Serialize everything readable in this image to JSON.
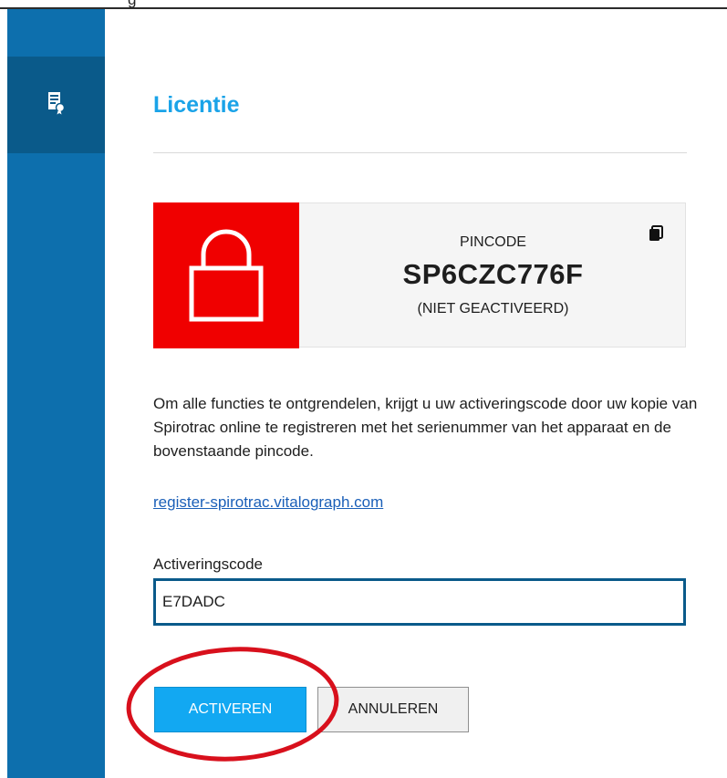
{
  "window": {
    "top_text_fragment": "g"
  },
  "sidebar": {
    "items": [
      {
        "icon": "license-certificate-icon",
        "active": true
      }
    ]
  },
  "page": {
    "title": "Licentie"
  },
  "pin": {
    "label": "PINCODE",
    "code": "SP6CZC776F",
    "status": "(NIET GEACTIVEERD)",
    "lock_icon": "padlock-icon",
    "copy_icon": "copy-icon"
  },
  "description": "Om alle functies te ontgrendelen, krijgt u uw activeringscode door uw kopie van Spirotrac online te registreren met het serienummer van het apparaat en de bovenstaande pincode.",
  "register_link": "register-spirotrac.vitalograph.com",
  "activation": {
    "label": "Activeringscode",
    "value": "E7DADC"
  },
  "buttons": {
    "activate": "ACTIVEREN",
    "cancel": "ANNULEREN"
  },
  "colors": {
    "sidebar": "#0d6fad",
    "sidebar_active": "#0a5a8a",
    "title": "#1aa3e8",
    "lock_bg": "#f00000",
    "activate_button": "#12a8f2",
    "annotation": "#d8101c"
  }
}
